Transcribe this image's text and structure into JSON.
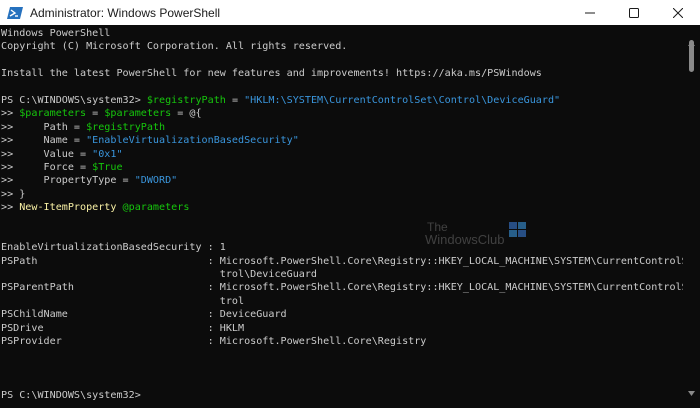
{
  "window": {
    "title": "Administrator: Windows PowerShell"
  },
  "colors": {
    "background": "#0c0c0c",
    "text": "#cccccc",
    "command": "#f9f1a5",
    "variable": "#16c60c",
    "string": "#3a96dd"
  },
  "console": {
    "lines": [
      [
        {
          "t": "Windows PowerShell",
          "c": "txt"
        }
      ],
      [
        {
          "t": "Copyright (C) Microsoft Corporation. All rights reserved.",
          "c": "txt"
        }
      ],
      [
        {
          "t": "",
          "c": "txt"
        }
      ],
      [
        {
          "t": "Install the latest PowerShell for new features and improvements! https://aka.ms/PSWindows",
          "c": "txt"
        }
      ],
      [
        {
          "t": "",
          "c": "txt"
        }
      ],
      [
        {
          "t": "PS C:\\WINDOWS\\system32> ",
          "c": "txt"
        },
        {
          "t": "$registryPath",
          "c": "var"
        },
        {
          "t": " = ",
          "c": "op"
        },
        {
          "t": "\"HKLM:\\SYSTEM\\CurrentControlSet\\Control\\DeviceGuard\"",
          "c": "str"
        }
      ],
      [
        {
          "t": ">> ",
          "c": "txt"
        },
        {
          "t": "$parameters",
          "c": "var"
        },
        {
          "t": " = ",
          "c": "op"
        },
        {
          "t": "$parameters",
          "c": "var"
        },
        {
          "t": " = @{",
          "c": "op"
        }
      ],
      [
        {
          "t": ">>     Path = ",
          "c": "txt"
        },
        {
          "t": "$registryPath",
          "c": "var"
        }
      ],
      [
        {
          "t": ">>     Name = ",
          "c": "txt"
        },
        {
          "t": "\"EnableVirtualizationBasedSecurity\"",
          "c": "str"
        }
      ],
      [
        {
          "t": ">>     Value = ",
          "c": "txt"
        },
        {
          "t": "\"0x1\"",
          "c": "str"
        }
      ],
      [
        {
          "t": ">>     Force = ",
          "c": "txt"
        },
        {
          "t": "$True",
          "c": "var"
        }
      ],
      [
        {
          "t": ">>     PropertyType = ",
          "c": "txt"
        },
        {
          "t": "\"DWORD\"",
          "c": "str"
        }
      ],
      [
        {
          "t": ">> }",
          "c": "txt"
        }
      ],
      [
        {
          "t": ">> ",
          "c": "txt"
        },
        {
          "t": "New-ItemProperty",
          "c": "cmd"
        },
        {
          "t": " @parameters",
          "c": "var"
        }
      ],
      [
        {
          "t": "",
          "c": "txt"
        }
      ],
      [
        {
          "t": "",
          "c": "txt"
        }
      ],
      [
        {
          "t": "EnableVirtualizationBasedSecurity : 1",
          "c": "txt"
        }
      ],
      [
        {
          "t": "PSPath                            : Microsoft.PowerShell.Core\\Registry::HKEY_LOCAL_MACHINE\\SYSTEM\\CurrentControlSet\\Con",
          "c": "txt"
        }
      ],
      [
        {
          "t": "                                    trol\\DeviceGuard",
          "c": "txt"
        }
      ],
      [
        {
          "t": "PSParentPath                      : Microsoft.PowerShell.Core\\Registry::HKEY_LOCAL_MACHINE\\SYSTEM\\CurrentControlSet\\Con",
          "c": "txt"
        }
      ],
      [
        {
          "t": "                                    trol",
          "c": "txt"
        }
      ],
      [
        {
          "t": "PSChildName                       : DeviceGuard",
          "c": "txt"
        }
      ],
      [
        {
          "t": "PSDrive                           : HKLM",
          "c": "txt"
        }
      ],
      [
        {
          "t": "PSProvider                        : Microsoft.PowerShell.Core\\Registry",
          "c": "txt"
        }
      ],
      [
        {
          "t": "",
          "c": "txt"
        }
      ],
      [
        {
          "t": "",
          "c": "txt"
        }
      ],
      [
        {
          "t": "",
          "c": "txt"
        }
      ],
      [
        {
          "t": "PS C:\\WINDOWS\\system32>",
          "c": "txt"
        }
      ]
    ]
  },
  "watermark": {
    "line1": "The",
    "line2": "WindowsClub"
  },
  "icons": {
    "app": "powershell-icon",
    "minimize": "minimize-icon",
    "maximize": "maximize-icon",
    "close": "close-icon"
  }
}
